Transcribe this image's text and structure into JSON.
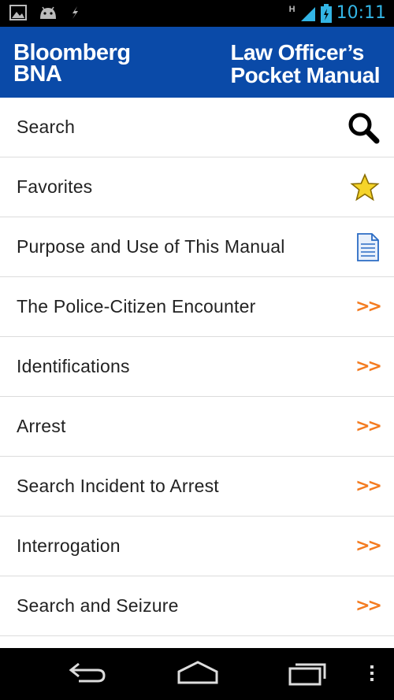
{
  "status_bar": {
    "time": "10:11",
    "network_label": "H",
    "icons": [
      "image-icon",
      "android-icon",
      "usb-icon",
      "signal-icon",
      "battery-icon"
    ]
  },
  "header": {
    "brand_line1": "Bloomberg",
    "brand_line2": "BNA",
    "title_line1": "Law Officer’s",
    "title_line2": "Pocket Manual",
    "background": "#0a4aa8"
  },
  "menu": {
    "items": [
      {
        "label": "Search",
        "icon": "search-icon"
      },
      {
        "label": "Favorites",
        "icon": "star-icon"
      },
      {
        "label": "Purpose and Use of This Manual",
        "icon": "document-icon"
      },
      {
        "label": "The Police-Citizen Encounter",
        "icon": "chevron-right-icon"
      },
      {
        "label": "Identifications",
        "icon": "chevron-right-icon"
      },
      {
        "label": "Arrest",
        "icon": "chevron-right-icon"
      },
      {
        "label": "Search Incident to Arrest",
        "icon": "chevron-right-icon"
      },
      {
        "label": "Interrogation",
        "icon": "chevron-right-icon"
      },
      {
        "label": "Search and Seizure",
        "icon": "chevron-right-icon"
      }
    ],
    "chevron_glyph": ">>",
    "accent": "#f47b20"
  },
  "nav_bar": {
    "buttons": [
      "back-icon",
      "home-icon",
      "recent-apps-icon",
      "overflow-menu-icon"
    ]
  }
}
